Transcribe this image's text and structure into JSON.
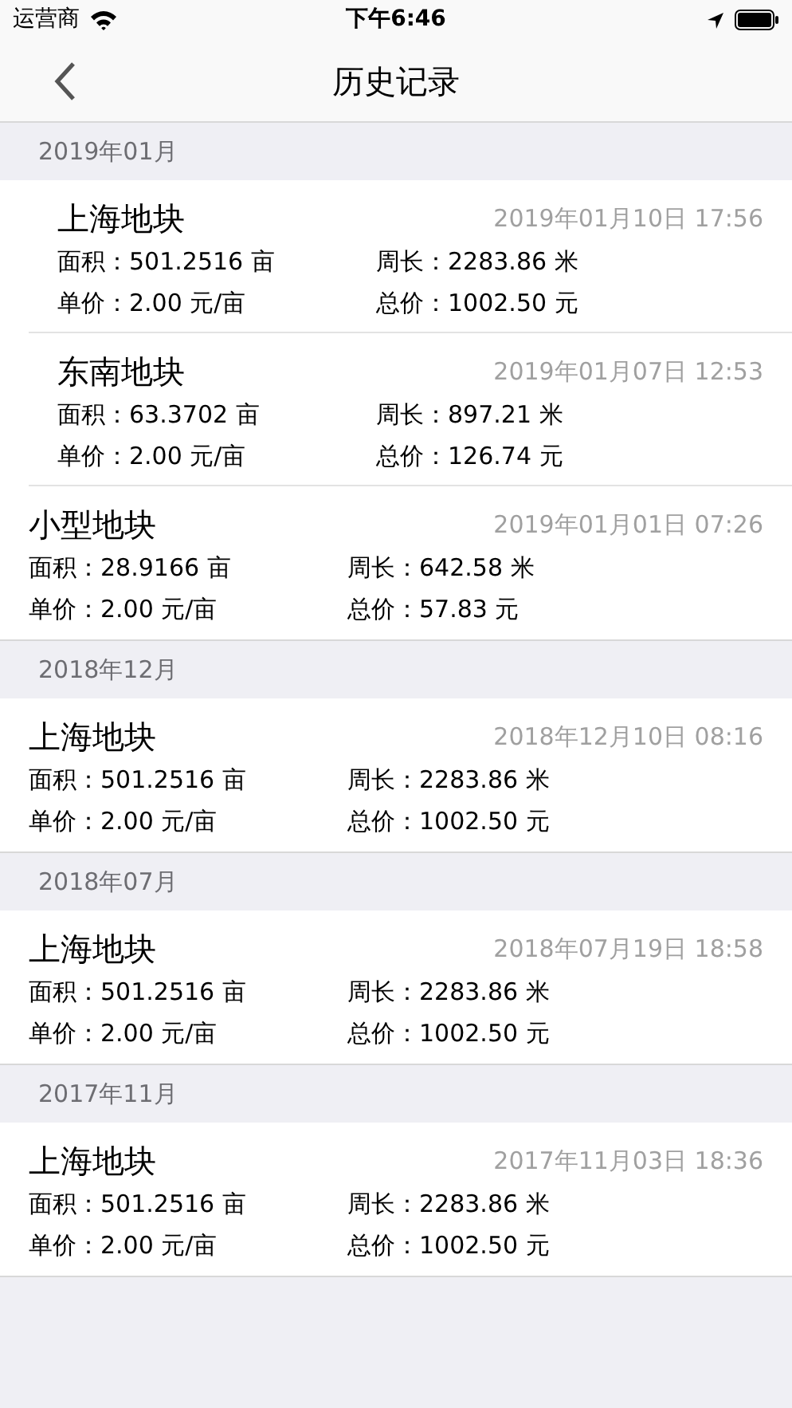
{
  "status_bar": {
    "carrier": "运营商",
    "time": "下午6:46"
  },
  "nav": {
    "title": "历史记录"
  },
  "sections": [
    {
      "header": "2019年01月",
      "items": [
        {
          "name": "上海地块",
          "date": "2019年01月10日 17:56",
          "area": "面积：501.2516 亩",
          "perimeter": "周长：2283.86 米",
          "unit_price": "单价：2.00 元/亩",
          "total": "总价：1002.50 元"
        },
        {
          "name": "东南地块",
          "date": "2019年01月07日 12:53",
          "area": "面积：63.3702 亩",
          "perimeter": "周长：897.21 米",
          "unit_price": "单价：2.00 元/亩",
          "total": "总价：126.74 元"
        },
        {
          "name": "小型地块",
          "date": "2019年01月01日 07:26",
          "area": "面积：28.9166 亩",
          "perimeter": "周长：642.58 米",
          "unit_price": "单价：2.00 元/亩",
          "total": "总价：57.83 元"
        }
      ]
    },
    {
      "header": "2018年12月",
      "items": [
        {
          "name": "上海地块",
          "date": "2018年12月10日 08:16",
          "area": "面积：501.2516 亩",
          "perimeter": "周长：2283.86 米",
          "unit_price": "单价：2.00 元/亩",
          "total": "总价：1002.50 元"
        }
      ]
    },
    {
      "header": "2018年07月",
      "items": [
        {
          "name": "上海地块",
          "date": "2018年07月19日 18:58",
          "area": "面积：501.2516 亩",
          "perimeter": "周长：2283.86 米",
          "unit_price": "单价：2.00 元/亩",
          "total": "总价：1002.50 元"
        }
      ]
    },
    {
      "header": "2017年11月",
      "items": [
        {
          "name": "上海地块",
          "date": "2017年11月03日 18:36",
          "area": "面积：501.2516 亩",
          "perimeter": "周长：2283.86 米",
          "unit_price": "单价：2.00 元/亩",
          "total": "总价：1002.50 元"
        }
      ]
    }
  ]
}
